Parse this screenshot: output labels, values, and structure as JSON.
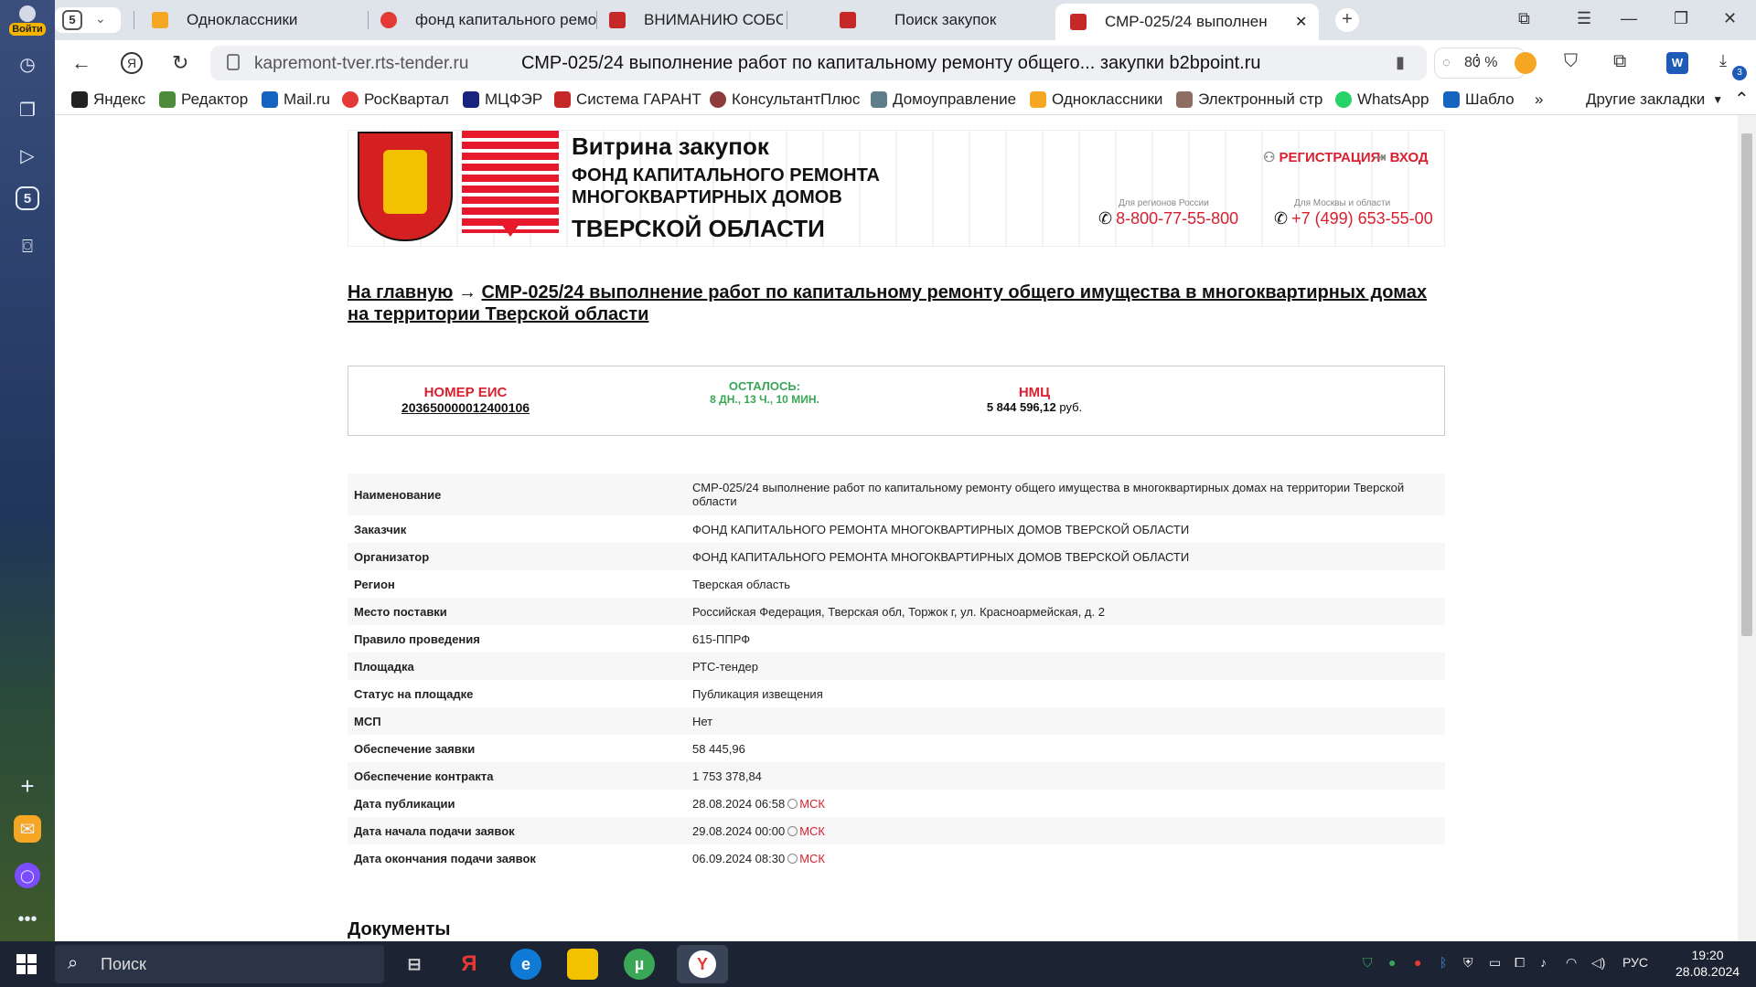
{
  "sidebar": {
    "login_label": "Войти",
    "tab_count": "5"
  },
  "tabs": [
    {
      "title": "Одноклассники",
      "color": "#f5a623"
    },
    {
      "title": "фонд капитального ремо",
      "color": "#e53935"
    },
    {
      "title": "ВНИМАНИЮ СОБСТВЕНН",
      "color": "#c62828"
    },
    {
      "title": "Поиск закупок",
      "color": "#c62828"
    },
    {
      "title": "СМР-025/24 выполнен",
      "color": "#c62828"
    }
  ],
  "tabstrip": {
    "count": "5"
  },
  "address": {
    "host": "kapremont-tver.rts-tender.ru",
    "title": "СМР-025/24 выполнение работ по капитальному ремонту общего... закупки b2bpoint.ru",
    "zoom": "80 %",
    "download_badge": "3"
  },
  "bookmarks": [
    {
      "label": "Яндекс",
      "color": "#222"
    },
    {
      "label": "Редактор",
      "color": "#4c8b3a"
    },
    {
      "label": "Mail.ru",
      "color": "#1565c0"
    },
    {
      "label": "РосКвартал",
      "color": "#e53935"
    },
    {
      "label": "МЦФЭР",
      "color": "#1a237e"
    },
    {
      "label": "Система ГАРАНТ",
      "color": "#c62828"
    },
    {
      "label": "КонсультантПлюс",
      "color": "#8d3b3b"
    },
    {
      "label": "Домоуправление",
      "color": "#607d8b"
    },
    {
      "label": "Одноклассники",
      "color": "#f5a623"
    },
    {
      "label": "Электронный стр",
      "color": "#8d6e63"
    },
    {
      "label": "WhatsApp",
      "color": "#25d366"
    },
    {
      "label": "Шабло",
      "color": "#1565c0"
    }
  ],
  "bookmarks_more": "»",
  "bookmarks_other": "Другие закладки",
  "banner": {
    "vitrina": "Витрина закупок",
    "org_line1": "ФОНД КАПИТАЛЬНОГО РЕМОНТА",
    "org_line2": "МНОГОКВАРТИРНЫХ ДОМОВ",
    "org_line3": "ТВЕРСКОЙ ОБЛАСТИ",
    "register": "РЕГИСТРАЦИЯ",
    "login": "ВХОД",
    "phone1_label": "Для регионов России",
    "phone1": "8-800-77-55-800",
    "phone2_label": "Для Москвы и области",
    "phone2": "+7 (499) 653-55-00"
  },
  "breadcrumb": {
    "home": "На главную",
    "arrow": "→",
    "current": "СМР-025/24 выполнение работ по капитальному ремонту общего имущества в многоквартирных домах на территории Тверской области"
  },
  "summary": {
    "eis_label": "НОМЕР ЕИС",
    "eis_value": "203650000012400106",
    "remaining_label": "ОСТАЛОСЬ:",
    "remaining_value": "8 ДН., 13 Ч., 10 МИН.",
    "nmc_label": "НМЦ",
    "nmc_value": "5 844 596,12",
    "nmc_unit": "руб."
  },
  "details": [
    {
      "k": "Наименование",
      "v": "СМР-025/24 выполнение работ по капитальному ремонту общего имущества в многоквартирных домах на территории Тверской области"
    },
    {
      "k": "Заказчик",
      "v": "ФОНД КАПИТАЛЬНОГО РЕМОНТА МНОГОКВАРТИРНЫХ ДОМОВ ТВЕРСКОЙ ОБЛАСТИ"
    },
    {
      "k": "Организатор",
      "v": "ФОНД КАПИТАЛЬНОГО РЕМОНТА МНОГОКВАРТИРНЫХ ДОМОВ ТВЕРСКОЙ ОБЛАСТИ"
    },
    {
      "k": "Регион",
      "v": "Тверская область"
    },
    {
      "k": "Место поставки",
      "v": "Российская Федерация, Тверская обл, Торжок г, ул. Красноармейская, д. 2"
    },
    {
      "k": "Правило проведения",
      "v": "615-ППРФ"
    },
    {
      "k": "Площадка",
      "v": "РТС-тендер"
    },
    {
      "k": "Статус на площадке",
      "v": "Публикация извещения"
    },
    {
      "k": "МСП",
      "v": "Нет"
    },
    {
      "k": "Обеспечение заявки",
      "v": "58 445,96"
    },
    {
      "k": "Обеспечение контракта",
      "v": "1 753 378,84"
    },
    {
      "k": "Дата публикации",
      "v": "28.08.2024 06:58",
      "tz": "МСК"
    },
    {
      "k": "Дата начала подачи заявок",
      "v": "29.08.2024 00:00",
      "tz": "МСК"
    },
    {
      "k": "Дата окончания подачи заявок",
      "v": "06.09.2024 08:30",
      "tz": "МСК"
    }
  ],
  "documents_title": "Документы",
  "taskbar": {
    "search_placeholder": "Поиск",
    "lang": "РУС",
    "time": "19:20",
    "date": "28.08.2024"
  }
}
